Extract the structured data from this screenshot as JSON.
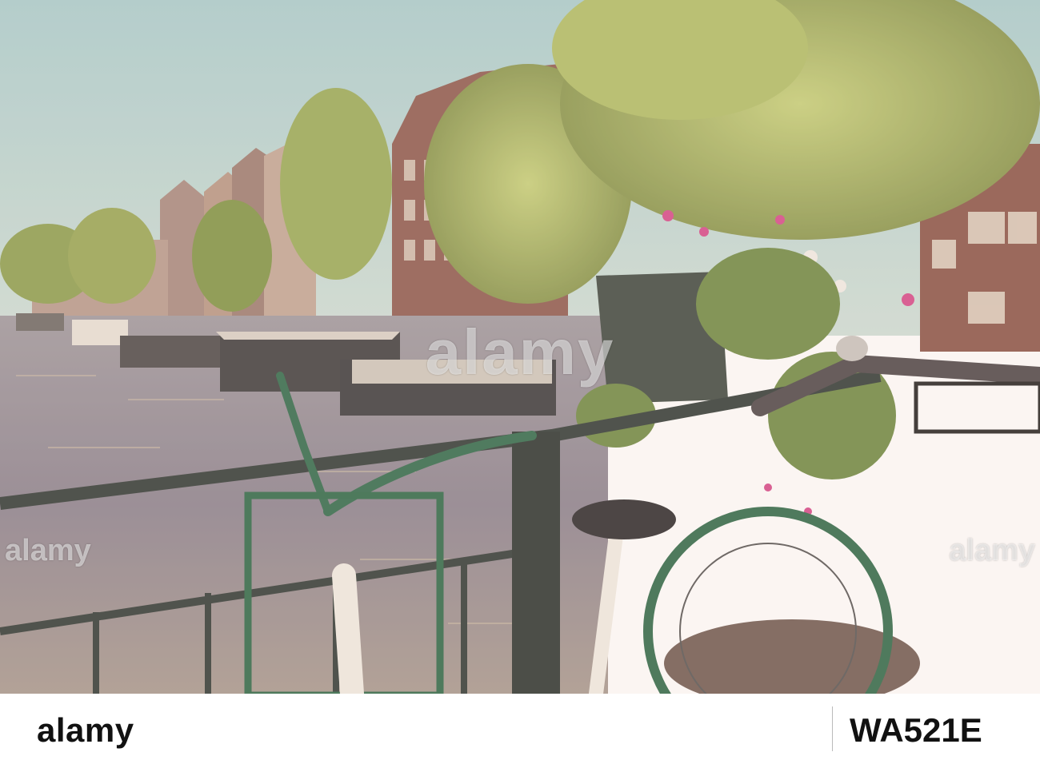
{
  "scene": {
    "description_tags": [
      "canal",
      "houseboats",
      "canal-houses",
      "trees",
      "bicycles",
      "railing",
      "flower-pot"
    ],
    "palette": {
      "sky": "#b9d6d6",
      "water": "#8f8a95",
      "foliage": "#a7b85a",
      "brick": "#8a5a4f",
      "rail": "#2f3a36"
    }
  },
  "watermark": {
    "center": "alamy",
    "left": "alamy",
    "right": "alamy"
  },
  "footer": {
    "logo": "alamy",
    "image_id": "WA521E"
  }
}
